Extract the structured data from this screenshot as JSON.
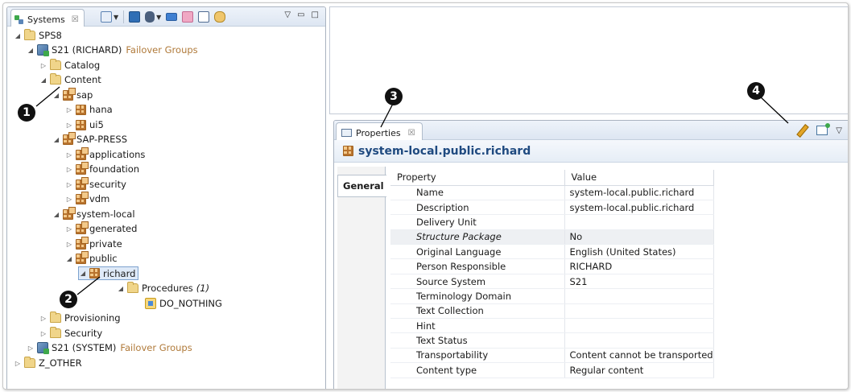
{
  "systems_view": {
    "tab_label": "Systems",
    "tab_close": "☒",
    "minimize": "▭",
    "maximize": "□",
    "view_menu": "▽"
  },
  "tree": {
    "nodes": [
      {
        "label": "SPS8",
        "icon": "folder-icon",
        "twisty": "expanded"
      },
      {
        "label": "S21 (RICHARD)",
        "suffix": "Failover Groups",
        "icon": "system-icon",
        "twisty": "expanded"
      },
      {
        "label": "Catalog",
        "icon": "folder-icon",
        "twisty": "collapsed"
      },
      {
        "label": "Content",
        "icon": "folder-icon",
        "twisty": "expanded"
      },
      {
        "label": "sap",
        "icon": "package-icon",
        "twisty": "expanded"
      },
      {
        "label": "hana",
        "icon": "package-icon",
        "twisty": "collapsed"
      },
      {
        "label": "ui5",
        "icon": "package-icon",
        "twisty": "collapsed"
      },
      {
        "label": "SAP-PRESS",
        "icon": "package-icon",
        "twisty": "expanded"
      },
      {
        "label": "applications",
        "icon": "package-icon",
        "twisty": "collapsed"
      },
      {
        "label": "foundation",
        "icon": "package-icon",
        "twisty": "collapsed"
      },
      {
        "label": "security",
        "icon": "package-icon",
        "twisty": "collapsed"
      },
      {
        "label": "vdm",
        "icon": "package-icon",
        "twisty": "collapsed"
      },
      {
        "label": "system-local",
        "icon": "package-icon",
        "twisty": "expanded"
      },
      {
        "label": "generated",
        "icon": "package-icon",
        "twisty": "collapsed"
      },
      {
        "label": "private",
        "icon": "package-icon",
        "twisty": "collapsed"
      },
      {
        "label": "public",
        "icon": "package-icon",
        "twisty": "expanded"
      },
      {
        "label": "richard",
        "icon": "package-icon",
        "twisty": "expanded",
        "selected": true
      },
      {
        "label": "Procedures",
        "count": "(1)",
        "icon": "folder-icon",
        "twisty": "expanded"
      },
      {
        "label": "DO_NOTHING",
        "icon": "procedure-icon",
        "twisty": "none"
      },
      {
        "label": "Provisioning",
        "icon": "folder-icon",
        "twisty": "collapsed"
      },
      {
        "label": "Security",
        "icon": "folder-icon",
        "twisty": "collapsed"
      },
      {
        "label": "S21 (SYSTEM)",
        "suffix": "Failover Groups",
        "icon": "system-icon",
        "twisty": "collapsed"
      },
      {
        "label": "Z_OTHER",
        "icon": "folder-icon",
        "twisty": "collapsed"
      }
    ]
  },
  "properties": {
    "tab_label": "Properties",
    "tab_close": "☒",
    "view_menu": "▽",
    "title": "system-local.public.richard",
    "side_tab": "General",
    "columns": [
      "Property",
      "Value"
    ],
    "rows": [
      {
        "key": "Name",
        "value": "system-local.public.richard"
      },
      {
        "key": "Description",
        "value": "system-local.public.richard"
      },
      {
        "key": "Delivery Unit",
        "value": ""
      },
      {
        "key": "Structure Package",
        "value": "No"
      },
      {
        "key": "Original Language",
        "value": "English (United States)"
      },
      {
        "key": "Person Responsible",
        "value": "RICHARD"
      },
      {
        "key": "Source System",
        "value": "S21"
      },
      {
        "key": "Terminology Domain",
        "value": ""
      },
      {
        "key": "Text Collection",
        "value": ""
      },
      {
        "key": "Hint",
        "value": ""
      },
      {
        "key": "Text Status",
        "value": ""
      },
      {
        "key": "Transportability",
        "value": "Content cannot be transported"
      },
      {
        "key": "Content type",
        "value": "Regular content"
      }
    ]
  },
  "callouts": [
    "1",
    "2",
    "3",
    "4"
  ]
}
